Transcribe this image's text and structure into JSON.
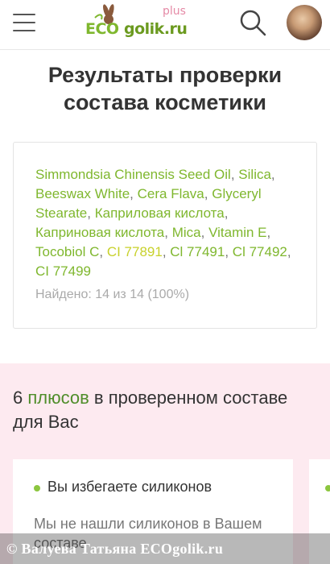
{
  "header": {
    "logo": {
      "eco": "ECO",
      "golik": "golik.ru",
      "plus": "plus"
    },
    "menu_icon": "hamburger-menu-icon",
    "search_icon": "search-icon",
    "avatar_icon": "user-avatar"
  },
  "page": {
    "title_line1": "Результаты проверки",
    "title_line2": "состава косметики"
  },
  "ingredients": {
    "items": [
      {
        "name": "Simmondsia Chinensis Seed Oil",
        "sep": ", ",
        "color": "green"
      },
      {
        "name": "Silica",
        "sep": ", ",
        "color": "green"
      },
      {
        "name": "Beeswax White",
        "sep": ", ",
        "color": "green"
      },
      {
        "name": "Cera Flava",
        "sep": ", ",
        "color": "green"
      },
      {
        "name": "Glyceryl Stearate",
        "sep": ", ",
        "color": "green"
      },
      {
        "name": "Каприловая кислота",
        "sep": ", ",
        "color": "green"
      },
      {
        "name": "Каприновая кислота",
        "sep": ", ",
        "color": "green"
      },
      {
        "name": "Mica",
        "sep": ", ",
        "color": "green"
      },
      {
        "name": "Vitamin E",
        "sep": ", ",
        "color": "green"
      },
      {
        "name": "Tocobiol C",
        "sep": ", ",
        "color": "green"
      },
      {
        "name": "CI 77891",
        "sep": ", ",
        "color": "yellow"
      },
      {
        "name": "Cl 77491",
        "sep": ", ",
        "color": "green"
      },
      {
        "name": "Cl 77492",
        "sep": ", ",
        "color": "green"
      },
      {
        "name": "CI 77499",
        "sep": "",
        "color": "green"
      }
    ],
    "found_text": "Найдено: 14 из 14 (100%)"
  },
  "pluses": {
    "count": "6",
    "word": "плюсов",
    "rest": "в проверенном составе для Вас",
    "cards": [
      {
        "title": "Вы избегаете силиконов",
        "text": "Мы не нашли силиконов в Вашем составе"
      }
    ]
  },
  "watermark": {
    "text": "© Валуева Татьяна ECOgolik.ru"
  },
  "colors": {
    "green": "#7fb72e",
    "yellow": "#c8d12b",
    "accent": "#4f8d2a",
    "pink_bg": "#fdeaf0"
  }
}
